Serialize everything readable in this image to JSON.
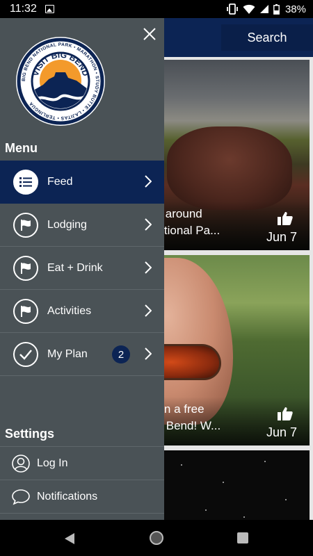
{
  "status_bar": {
    "time": "11:32",
    "battery": "38%"
  },
  "header": {
    "search_label": "Search"
  },
  "feed": {
    "cards": [
      {
        "caption": "ures around\nd National Pa...",
        "date": "Jun 7"
      },
      {
        "caption": "u won a free\nt Big Bend! W...",
        "date": "Jun 7"
      }
    ]
  },
  "logo": {
    "ring_text": "BIG BEND NATIONAL PARK • MARATHON • STUDY BUTTE • LAJITAS • TERLINGUA",
    "center_text": "VISIT BIG BEND"
  },
  "drawer": {
    "menu_title": "Menu",
    "items": [
      {
        "label": "Feed",
        "icon": "list-icon",
        "active": true
      },
      {
        "label": "Lodging",
        "icon": "flag-icon"
      },
      {
        "label": "Eat + Drink",
        "icon": "flag-icon"
      },
      {
        "label": "Activities",
        "icon": "flag-icon"
      },
      {
        "label": "My Plan",
        "icon": "check-icon",
        "badge": "2"
      }
    ],
    "settings_title": "Settings",
    "settings_items": [
      {
        "label": "Log In",
        "icon": "user-icon"
      },
      {
        "label": "Notifications",
        "icon": "chat-bubble-icon"
      }
    ]
  },
  "colors": {
    "navy": "#0c2454",
    "drawer_bg": "#4a5256",
    "logo_orange": "#f39a2b"
  }
}
